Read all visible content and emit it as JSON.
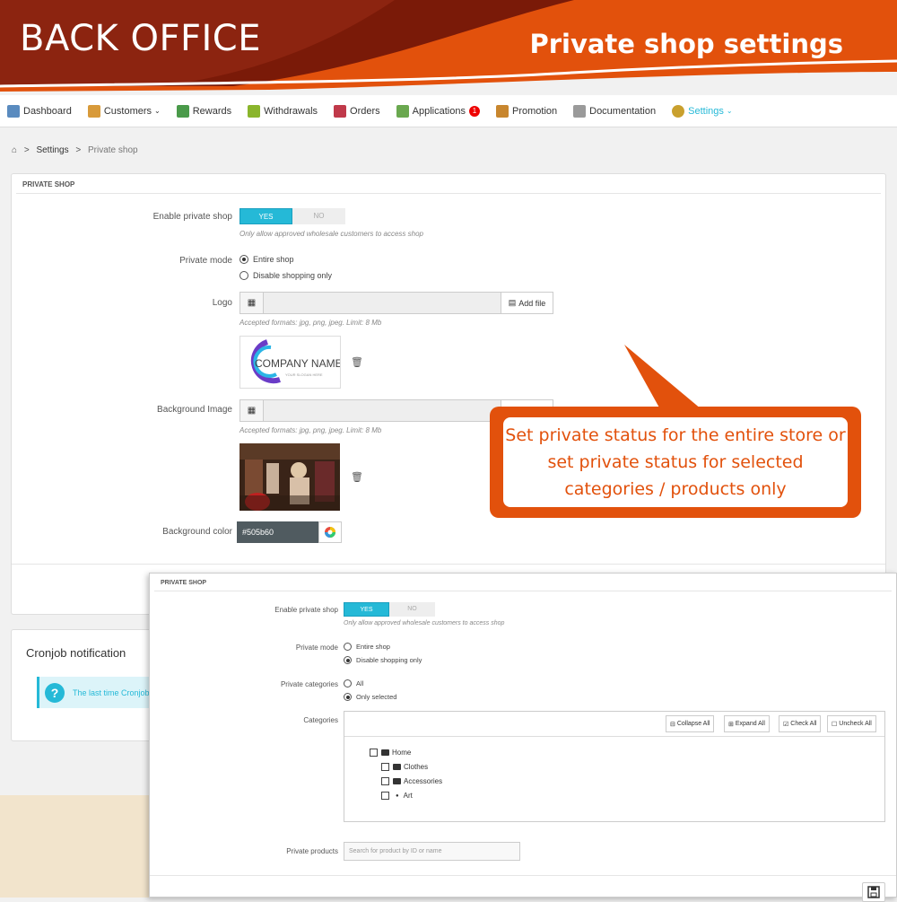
{
  "banner": {
    "left_title": "BACK OFFICE",
    "right_title": "Private shop settings"
  },
  "nav": {
    "items": [
      {
        "label": "Dashboard",
        "icon": "dashboard-icon"
      },
      {
        "label": "Customers",
        "icon": "customers-icon",
        "chevron": true
      },
      {
        "label": "Rewards",
        "icon": "rewards-icon"
      },
      {
        "label": "Withdrawals",
        "icon": "withdrawals-icon"
      },
      {
        "label": "Orders",
        "icon": "cart-icon"
      },
      {
        "label": "Applications",
        "icon": "applications-icon",
        "badge": "1"
      },
      {
        "label": "Promotion",
        "icon": "promotion-icon"
      },
      {
        "label": "Documentation",
        "icon": "documentation-icon"
      },
      {
        "label": "Settings",
        "icon": "settings-icon",
        "chevron": true,
        "active": true
      }
    ]
  },
  "breadcrumb": {
    "sep": ">",
    "settings": "Settings",
    "current": "Private shop"
  },
  "panel1": {
    "header": "PRIVATE SHOP",
    "enable_label": "Enable private shop",
    "yes": "YES",
    "no": "NO",
    "enable_help": "Only allow approved wholesale customers to access shop",
    "mode_label": "Private mode",
    "mode_opt1": "Entire shop",
    "mode_opt2": "Disable shopping only",
    "logo_label": "Logo",
    "add_file": "Add file",
    "accepted": "Accepted formats: jpg, png, jpeg. Limit: 8 Mb",
    "logo_text": "COMPANY NAME",
    "logo_tagline": "YOUR SLOGAN HERE",
    "bg_label": "Background Image",
    "accepted2": "Accepted formats: jpg, png, jpeg. Limit: 8 Mb",
    "color_label": "Background color",
    "color_value": "#505b60"
  },
  "cron": {
    "title": "Cronjob notification",
    "info": "The last time Cronjob"
  },
  "callout": {
    "text": "Set private status for the entire store or set private status for selected categories / products only"
  },
  "panel2": {
    "header": "PRIVATE SHOP",
    "enable_label": "Enable private shop",
    "yes": "YES",
    "no": "NO",
    "enable_help": "Only allow approved wholesale customers to access shop",
    "mode_label": "Private mode",
    "mode_opt1": "Entire shop",
    "mode_opt2": "Disable shopping only",
    "cat_label": "Private categories",
    "cat_opt1": "All",
    "cat_opt2": "Only selected",
    "categories_label": "Categories",
    "collapse_all": "Collapse All",
    "expand_all": "Expand All",
    "check_all": "Check All",
    "uncheck_all": "Uncheck All",
    "tree": [
      "Home",
      "Clothes",
      "Accessories",
      "Art"
    ],
    "products_label": "Private products",
    "search_placeholder": "Search for product by ID or name"
  },
  "colors": {
    "accent": "#25b9d7",
    "banner_orange": "#e2510c",
    "banner_dark": "#7a1a08"
  }
}
